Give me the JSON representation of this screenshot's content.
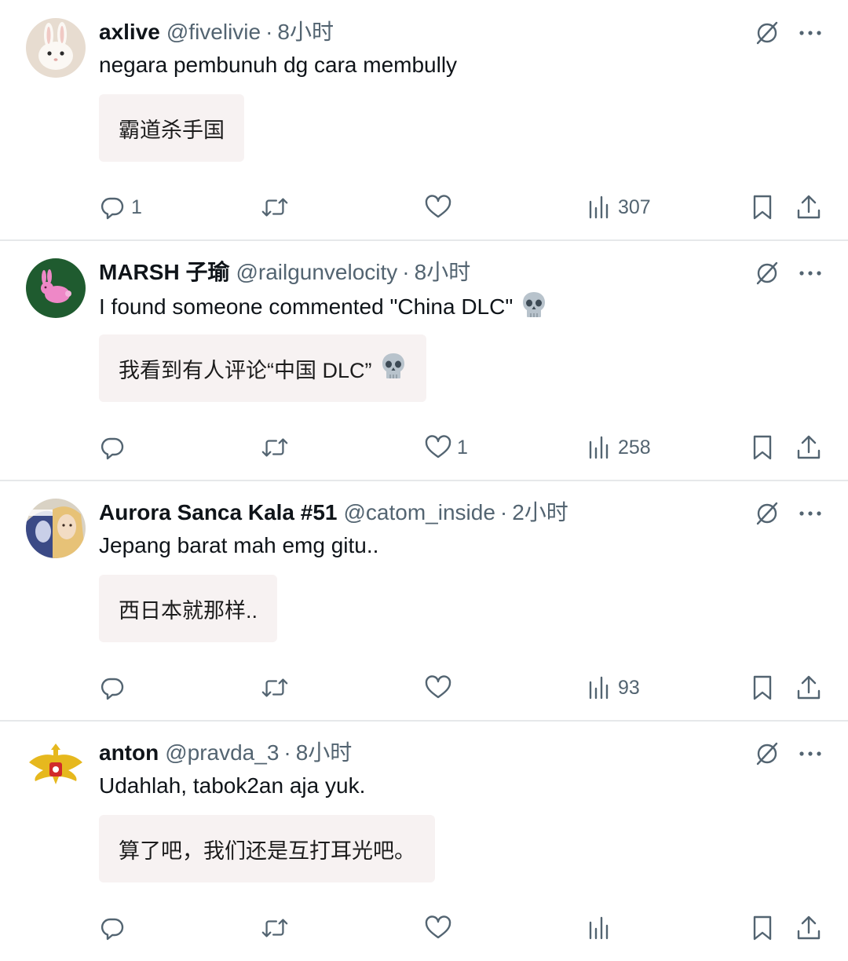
{
  "tweets": [
    {
      "display_name": "axlive",
      "handle": "@fivelivie",
      "separator": "·",
      "time": "8小时",
      "text": "negara pembunuh dg cara membully",
      "translation": "霸道杀手国",
      "has_skull": false,
      "text_skull": false,
      "replies": "1",
      "retweets": "",
      "likes": "",
      "views": "307",
      "avatar": "rabbit-avatar"
    },
    {
      "display_name": "MARSH 子瑜",
      "handle": "@railgunvelocity",
      "separator": "·",
      "time": "8小时",
      "text": "I found someone commented \"China DLC\"",
      "translation": "我看到有人评论“中国 DLC”",
      "has_skull": true,
      "text_skull": true,
      "replies": "",
      "retweets": "",
      "likes": "1",
      "views": "258",
      "avatar": "pink-rabbit-avatar"
    },
    {
      "display_name": "Aurora Sanca Kala #51",
      "handle": "@catom_inside",
      "separator": "·",
      "time": "2小时",
      "text": "Jepang barat mah emg gitu..",
      "translation": "西日本就那样..",
      "has_skull": false,
      "text_skull": false,
      "replies": "",
      "retweets": "",
      "likes": "",
      "views": "93",
      "avatar": "anime-avatar"
    },
    {
      "display_name": "anton",
      "handle": "@pravda_3",
      "separator": "·",
      "time": "8小时",
      "text": "Udahlah, tabok2an aja yuk.",
      "translation": "算了吧，我们还是互打耳光吧。",
      "has_skull": false,
      "text_skull": false,
      "replies": "",
      "retweets": "",
      "likes": "",
      "views": "",
      "avatar": "eagle-emblem-avatar"
    }
  ],
  "colors": {
    "text_primary": "#0f1419",
    "text_secondary": "#536471",
    "translation_bg": "#f7f2f2",
    "divider": "#e6e8ea"
  },
  "icons": {
    "grok": "grok-icon",
    "more": "more-dots-icon",
    "reply": "reply-icon",
    "retweet": "retweet-icon",
    "like": "heart-icon",
    "views": "views-icon",
    "bookmark": "bookmark-icon",
    "share": "share-icon",
    "skull": "skull-emoji-icon"
  }
}
